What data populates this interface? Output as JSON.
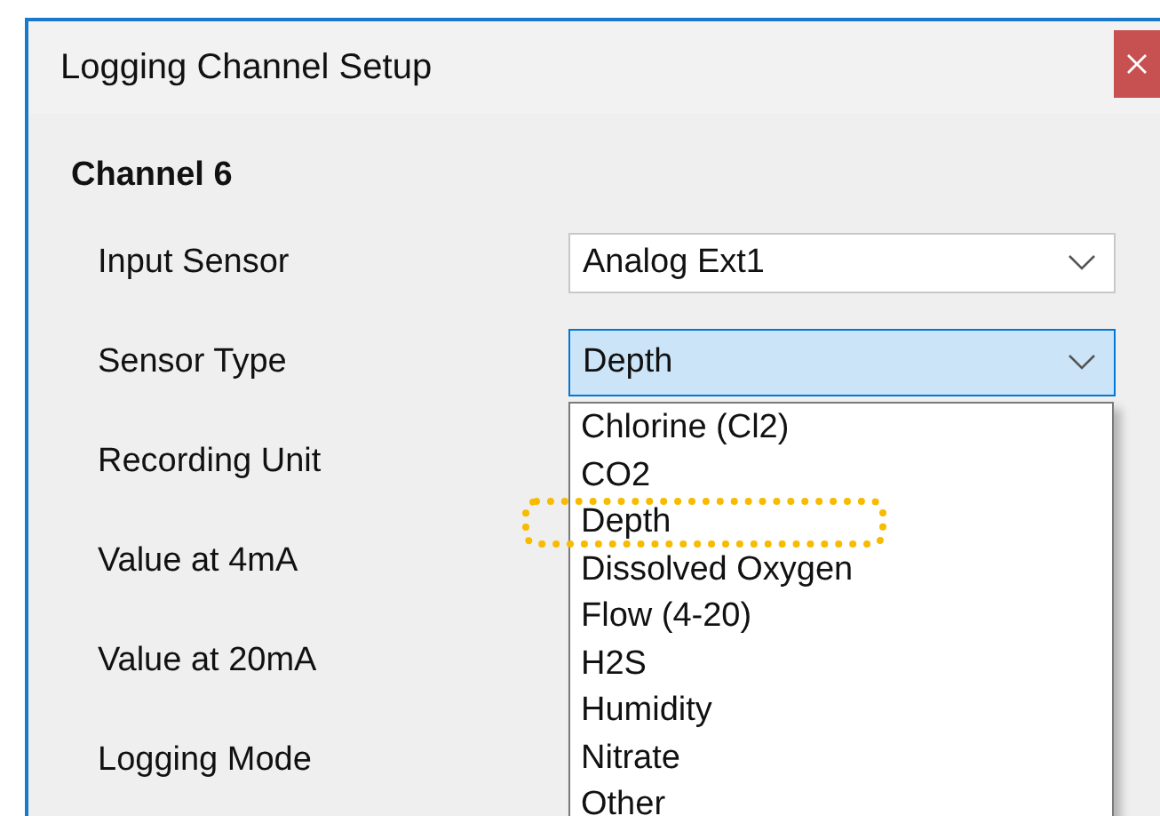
{
  "window": {
    "title": "Logging Channel Setup"
  },
  "section": {
    "heading": "Channel 6"
  },
  "fields": [
    {
      "label": "Input Sensor",
      "kind": "combo",
      "value": "Analog Ext1",
      "focused": false
    },
    {
      "label": "Sensor Type",
      "kind": "combo",
      "value": "Depth",
      "focused": true,
      "options": [
        {
          "label": "Chlorine (Cl2)",
          "annotated": false
        },
        {
          "label": "CO2",
          "annotated": false
        },
        {
          "label": "Depth",
          "annotated": true
        },
        {
          "label": "Dissolved Oxygen",
          "annotated": false
        },
        {
          "label": "Flow (4-20)",
          "annotated": false
        },
        {
          "label": "H2S",
          "annotated": false
        },
        {
          "label": "Humidity",
          "annotated": false
        },
        {
          "label": "Nitrate",
          "annotated": false
        },
        {
          "label": "Other",
          "annotated": false
        }
      ]
    },
    {
      "label": "Recording Unit",
      "kind": "label"
    },
    {
      "label": "Value at 4mA",
      "kind": "label"
    },
    {
      "label": "Value at 20mA",
      "kind": "label"
    },
    {
      "label": "Logging Mode",
      "kind": "label"
    }
  ]
}
